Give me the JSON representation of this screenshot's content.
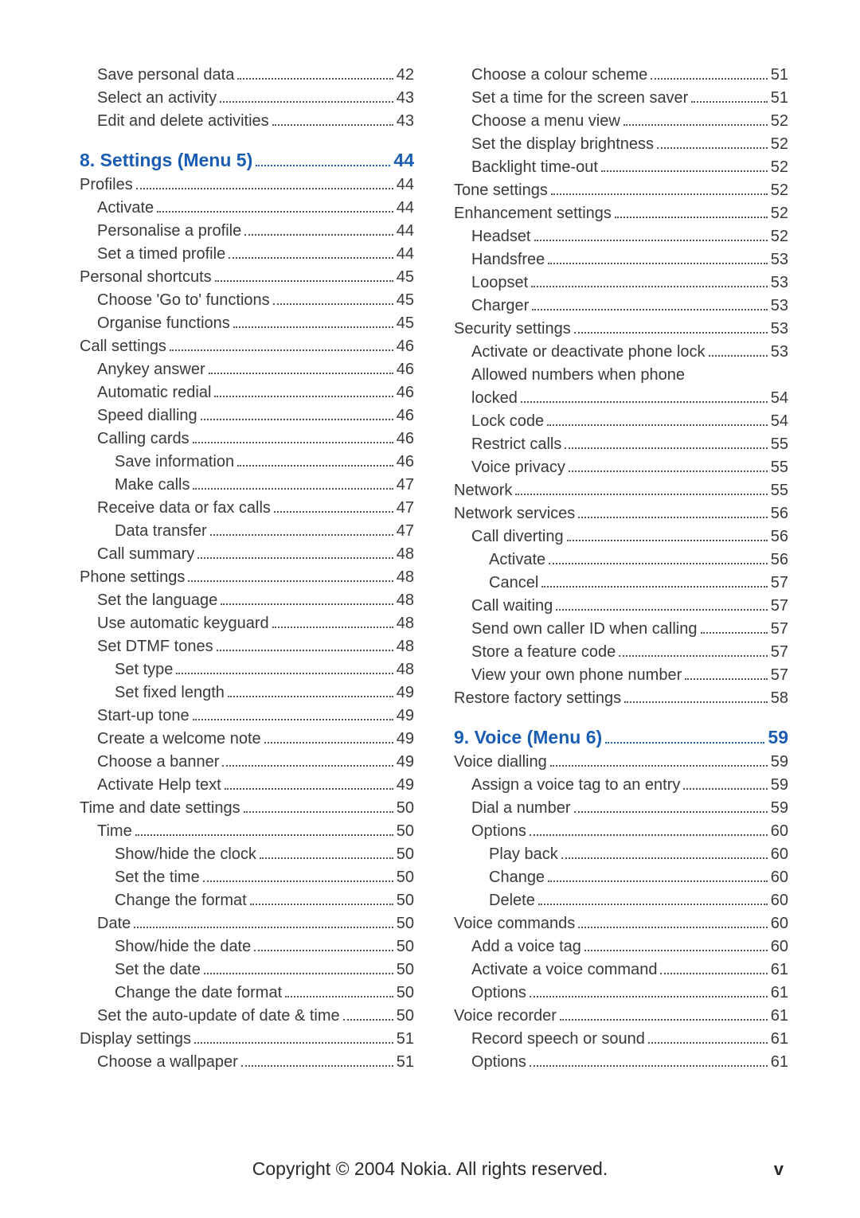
{
  "footer": {
    "copyright": "Copyright © 2004 Nokia. All rights reserved.",
    "pagenum": "v"
  },
  "left": [
    {
      "text": "Save personal data",
      "page": "42",
      "indent": 1
    },
    {
      "text": "Select an activity",
      "page": "43",
      "indent": 1
    },
    {
      "text": "Edit and delete activities",
      "page": "43",
      "indent": 1
    },
    {
      "text": "8. Settings (Menu 5) ",
      "page": "44",
      "indent": 0,
      "heading": true,
      "gap": true
    },
    {
      "text": "Profiles",
      "page": "44",
      "indent": 0
    },
    {
      "text": "Activate",
      "page": "44",
      "indent": 1
    },
    {
      "text": "Personalise a profile",
      "page": "44",
      "indent": 1
    },
    {
      "text": "Set a timed profile",
      "page": "44",
      "indent": 1
    },
    {
      "text": "Personal shortcuts",
      "page": "45",
      "indent": 0
    },
    {
      "text": "Choose 'Go to' functions",
      "page": "45",
      "indent": 1
    },
    {
      "text": "Organise functions",
      "page": "45",
      "indent": 1
    },
    {
      "text": "Call settings",
      "page": "46",
      "indent": 0
    },
    {
      "text": "Anykey answer",
      "page": "46",
      "indent": 1
    },
    {
      "text": "Automatic redial",
      "page": "46",
      "indent": 1
    },
    {
      "text": "Speed dialling",
      "page": "46",
      "indent": 1
    },
    {
      "text": "Calling cards",
      "page": "46",
      "indent": 1
    },
    {
      "text": "Save information",
      "page": "46",
      "indent": 2
    },
    {
      "text": "Make calls",
      "page": "47",
      "indent": 2
    },
    {
      "text": "Receive data or fax calls",
      "page": "47",
      "indent": 1
    },
    {
      "text": "Data transfer",
      "page": "47",
      "indent": 2
    },
    {
      "text": "Call summary",
      "page": "48",
      "indent": 1
    },
    {
      "text": "Phone settings",
      "page": "48",
      "indent": 0
    },
    {
      "text": "Set the language",
      "page": "48",
      "indent": 1
    },
    {
      "text": "Use automatic keyguard",
      "page": "48",
      "indent": 1
    },
    {
      "text": "Set DTMF tones",
      "page": "48",
      "indent": 1
    },
    {
      "text": "Set type",
      "page": "48",
      "indent": 2
    },
    {
      "text": "Set fixed length",
      "page": "49",
      "indent": 2
    },
    {
      "text": "Start-up tone",
      "page": "49",
      "indent": 1
    },
    {
      "text": "Create a welcome note",
      "page": "49",
      "indent": 1
    },
    {
      "text": "Choose a banner",
      "page": "49",
      "indent": 1
    },
    {
      "text": "Activate Help text",
      "page": "49",
      "indent": 1
    },
    {
      "text": "Time and date settings",
      "page": "50",
      "indent": 0
    },
    {
      "text": "Time",
      "page": "50",
      "indent": 1
    },
    {
      "text": "Show/hide the clock",
      "page": "50",
      "indent": 2
    },
    {
      "text": "Set the time",
      "page": "50",
      "indent": 2
    },
    {
      "text": "Change the format",
      "page": "50",
      "indent": 2
    },
    {
      "text": "Date",
      "page": "50",
      "indent": 1
    },
    {
      "text": "Show/hide the date",
      "page": "50",
      "indent": 2
    },
    {
      "text": "Set the date",
      "page": "50",
      "indent": 2
    },
    {
      "text": "Change the date format",
      "page": "50",
      "indent": 2
    },
    {
      "text": "Set the auto-update of date & time",
      "page": "50",
      "indent": 1
    },
    {
      "text": "Display settings",
      "page": "51",
      "indent": 0
    },
    {
      "text": "Choose a wallpaper",
      "page": "51",
      "indent": 1
    }
  ],
  "right": [
    {
      "text": "Choose a colour scheme",
      "page": "51",
      "indent": 1
    },
    {
      "text": "Set a time for the screen saver",
      "page": "51",
      "indent": 1
    },
    {
      "text": "Choose a menu view",
      "page": "52",
      "indent": 1
    },
    {
      "text": "Set the display brightness",
      "page": "52",
      "indent": 1
    },
    {
      "text": "Backlight time-out",
      "page": "52",
      "indent": 1
    },
    {
      "text": "Tone settings",
      "page": "52",
      "indent": 0
    },
    {
      "text": "Enhancement settings",
      "page": "52",
      "indent": 0
    },
    {
      "text": "Headset",
      "page": "52",
      "indent": 1
    },
    {
      "text": "Handsfree",
      "page": "53",
      "indent": 1
    },
    {
      "text": "Loopset",
      "page": "53",
      "indent": 1
    },
    {
      "text": "Charger",
      "page": "53",
      "indent": 1
    },
    {
      "text": "Security settings",
      "page": "53",
      "indent": 0
    },
    {
      "text": "Activate or deactivate phone lock",
      "page": "53",
      "indent": 1
    },
    {
      "text": "Allowed numbers when phone",
      "indent": 1,
      "wrapstart": true
    },
    {
      "text": "locked",
      "page": "54",
      "indent": 1
    },
    {
      "text": "Lock code",
      "page": "54",
      "indent": 1
    },
    {
      "text": "Restrict calls",
      "page": "55",
      "indent": 1
    },
    {
      "text": "Voice privacy",
      "page": "55",
      "indent": 1
    },
    {
      "text": "Network",
      "page": "55",
      "indent": 0
    },
    {
      "text": "Network services",
      "page": "56",
      "indent": 0
    },
    {
      "text": "Call diverting",
      "page": "56",
      "indent": 1
    },
    {
      "text": "Activate",
      "page": "56",
      "indent": 2
    },
    {
      "text": "Cancel",
      "page": "57",
      "indent": 2
    },
    {
      "text": "Call waiting",
      "page": "57",
      "indent": 1
    },
    {
      "text": "Send own caller ID when calling",
      "page": "57",
      "indent": 1
    },
    {
      "text": "Store a feature code",
      "page": "57",
      "indent": 1
    },
    {
      "text": "View your own phone number",
      "page": "57",
      "indent": 1
    },
    {
      "text": "Restore factory settings",
      "page": "58",
      "indent": 0
    },
    {
      "text": "9. Voice (Menu 6)",
      "page": "59",
      "indent": 0,
      "heading": true,
      "gap": true
    },
    {
      "text": "Voice dialling",
      "page": "59",
      "indent": 0
    },
    {
      "text": "Assign a voice tag to an entry",
      "page": "59",
      "indent": 1
    },
    {
      "text": "Dial a number",
      "page": "59",
      "indent": 1
    },
    {
      "text": "Options",
      "page": "60",
      "indent": 1
    },
    {
      "text": "Play back",
      "page": "60",
      "indent": 2
    },
    {
      "text": "Change",
      "page": "60",
      "indent": 2
    },
    {
      "text": "Delete",
      "page": "60",
      "indent": 2
    },
    {
      "text": "Voice commands",
      "page": "60",
      "indent": 0
    },
    {
      "text": "Add a voice tag",
      "page": "60",
      "indent": 1
    },
    {
      "text": "Activate a voice command",
      "page": "61",
      "indent": 1
    },
    {
      "text": "Options",
      "page": "61",
      "indent": 1
    },
    {
      "text": "Voice recorder",
      "page": "61",
      "indent": 0
    },
    {
      "text": "Record speech or sound",
      "page": "61",
      "indent": 1
    },
    {
      "text": "Options",
      "page": "61",
      "indent": 1
    }
  ]
}
